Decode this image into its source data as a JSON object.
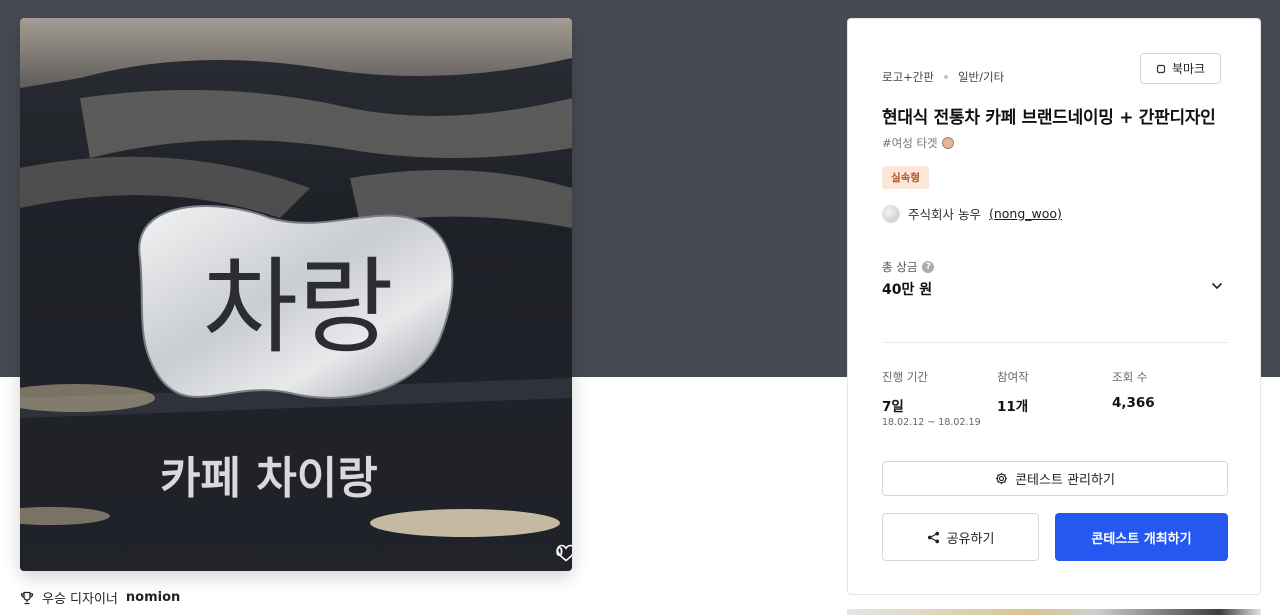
{
  "image": {
    "sign_text_main": "차랑",
    "sign_text_sub": "카페 차이랑",
    "like_count": "0"
  },
  "winner": {
    "label": "우승 디자이너",
    "name": "nomion"
  },
  "panel": {
    "bookmark_label": "북마크",
    "categories": [
      "로고+간판",
      "일반/기타"
    ],
    "title": "현대식 전통차 카페 브랜드네이밍 + 간판디자인",
    "tag": "#여성 타겟",
    "type_badge": "실속형",
    "host_name": "주식회사 농우",
    "host_id": "(nong_woo)",
    "prize_label": "총 상금",
    "prize_value": "40만 원",
    "stats": {
      "period_label": "진행 기간",
      "period_value": "7일",
      "period_range": "18.02.12 ~ 18.02.19",
      "entries_label": "참여작",
      "entries_value": "11개",
      "views_label": "조회 수",
      "views_value": "4,366"
    },
    "manage_button": "콘테스트 관리하기",
    "share_button": "공유하기",
    "host_button": "콘테스트 개최하기"
  },
  "colors": {
    "hero_bg": "#464a52",
    "accent_blue": "#2458f0",
    "badge_bg": "#fbe6d8",
    "badge_text": "#b0572b"
  },
  "icons": [
    "heart-icon",
    "trophy-icon",
    "bookmark-icon",
    "help-icon",
    "chevron-down-icon",
    "gear-icon",
    "share-icon"
  ]
}
